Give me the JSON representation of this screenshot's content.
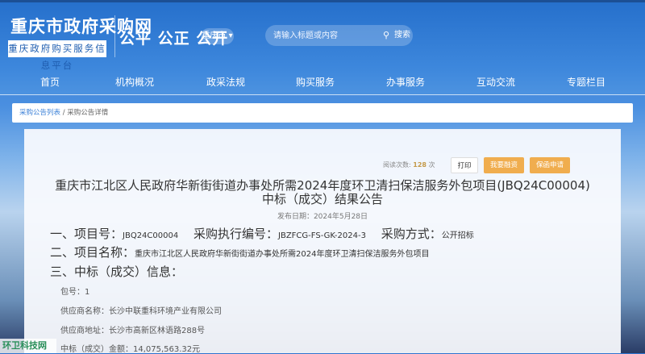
{
  "header": {
    "site_title": "重庆市政府采购网",
    "subtitle": "重庆政府购买服务信息平台",
    "slogan": "公平 公正 公开",
    "city": "重庆市",
    "search_placeholder": "请输入标题或内容",
    "search_button": "搜索"
  },
  "nav": [
    "首页",
    "机构概况",
    "政采法规",
    "购买服务",
    "办事服务",
    "互动交流",
    "专题栏目"
  ],
  "breadcrumb": {
    "parent": "采购公告列表",
    "separator": "/",
    "current": "采购公告详情"
  },
  "toolbar": {
    "reads_label": "阅读次数:",
    "reads_count": "128",
    "reads_unit": "次",
    "print": "打印",
    "finance": "我要融资",
    "guarantee": "保函申请"
  },
  "notice": {
    "title_line1": "重庆市江北区人民政府华新街街道办事处所需2024年度环卫清扫保洁服务外包项目(JBQ24C00004)",
    "title_line2": "中标（成交）结果公告",
    "date_label": "发布日期：",
    "date": "2024年5月28日",
    "s1_label": "一、项目号：",
    "project_no": "JBQ24C00004",
    "exec_label": "采购执行编号：",
    "exec_no": "JBZFCG-FS-GK-2024-3",
    "method_label": "采购方式：",
    "method": "公开招标",
    "s2_label": "二、项目名称：",
    "project_name": "重庆市江北区人民政府华新街街道办事处所需2024年度环卫清扫保洁服务外包项目",
    "s3_label": "三、中标（成交）信息：",
    "package_label": "包号：",
    "package": "1",
    "supplier_label": "供应商名称：",
    "supplier": "长沙中联重科环境产业有限公司",
    "address_label": "供应商地址：",
    "address": "长沙市高新区林语路288号",
    "amount_label": "中标（成交）金额：",
    "amount": "14,075,563.32元"
  },
  "watermark": "环卫科技网",
  "colors": {
    "brand": "#2670cc",
    "button_orange": "#f0ad4e"
  }
}
